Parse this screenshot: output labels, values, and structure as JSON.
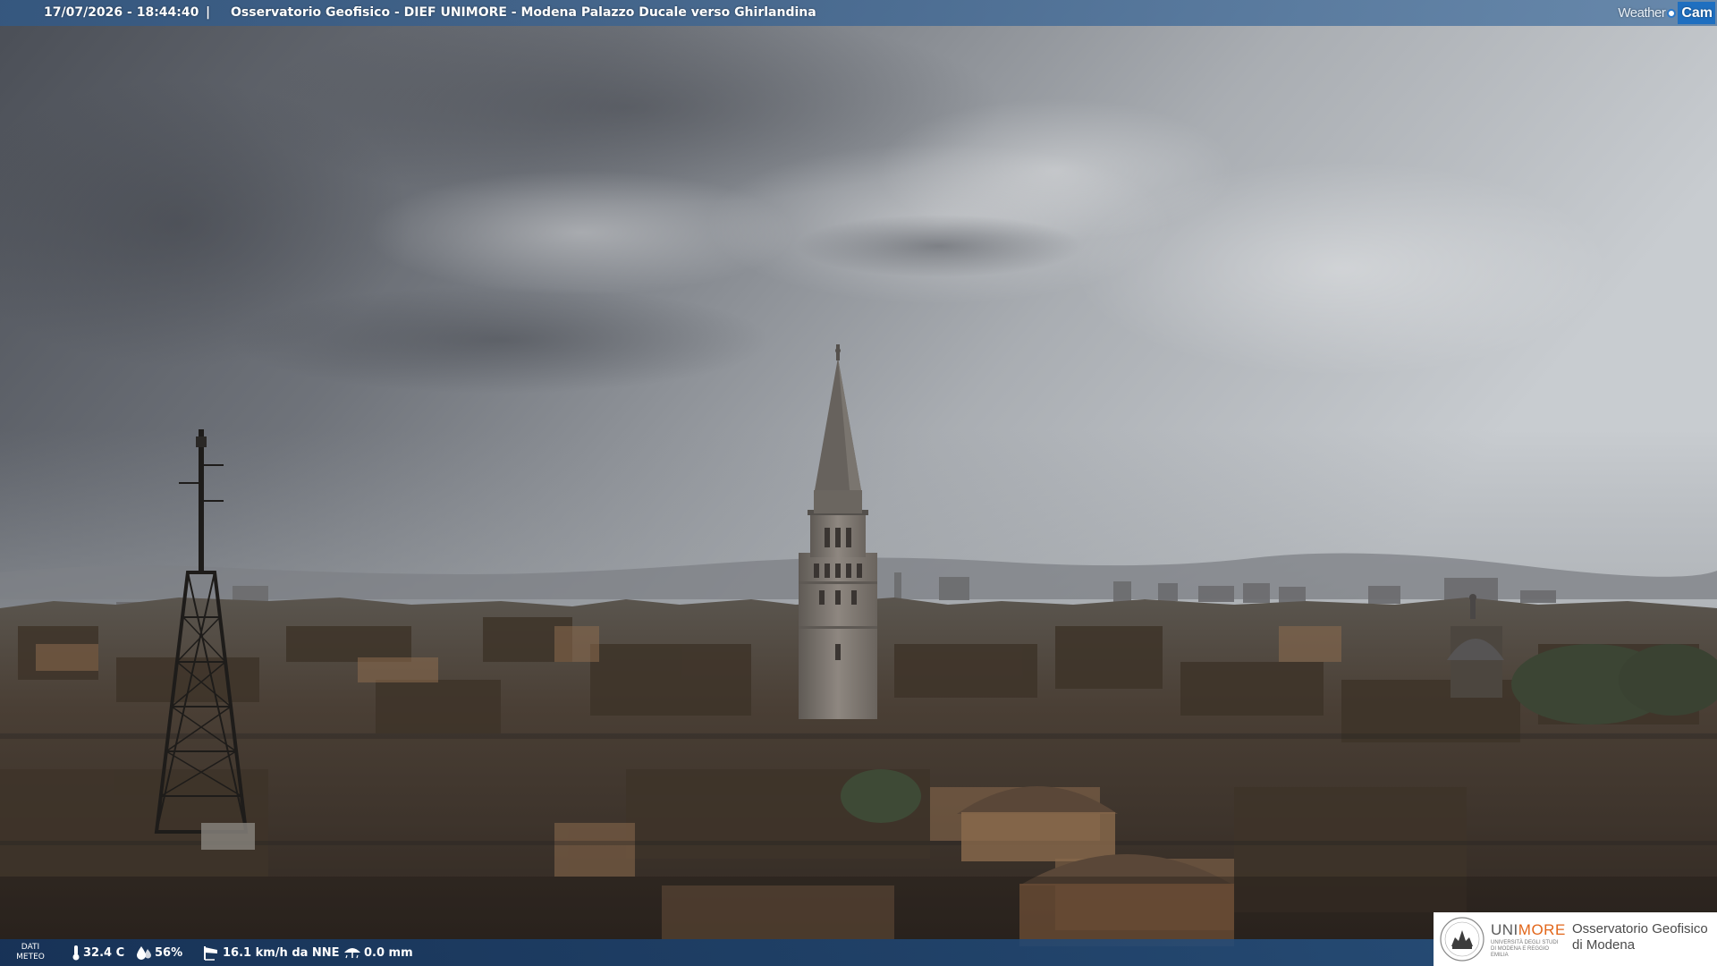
{
  "header": {
    "datetime": "17/07/2026 - 18:44:40",
    "separator": "|",
    "title": "Osservatorio Geofisico - DIEF UNIMORE - Modena Palazzo Ducale verso Ghirlandina"
  },
  "brand": {
    "weather_label": "Weather",
    "cam_label": "Cam",
    "accent_color": "#1f6fc0"
  },
  "weather_bar": {
    "section_label_line1": "DATI",
    "section_label_line2": "METEO",
    "temperature": "32.4 C",
    "humidity": "56%",
    "wind": "16.1 km/h da NNE",
    "rain": "0.0 mm",
    "icons": [
      "thermometer-icon",
      "humidity-drop-icon",
      "wind-sock-icon",
      "rain-gauge-icon"
    ],
    "bar_color": "#1e4470"
  },
  "logo": {
    "name_part1": "UNI",
    "name_part2": "MORE",
    "subtitle": "UNIVERSITÀ DEGLI STUDI DI MODENA E REGGIO EMILIA",
    "observatory": "Osservatorio Geofisico\ndi Modena",
    "accent_color": "#e2661a"
  }
}
